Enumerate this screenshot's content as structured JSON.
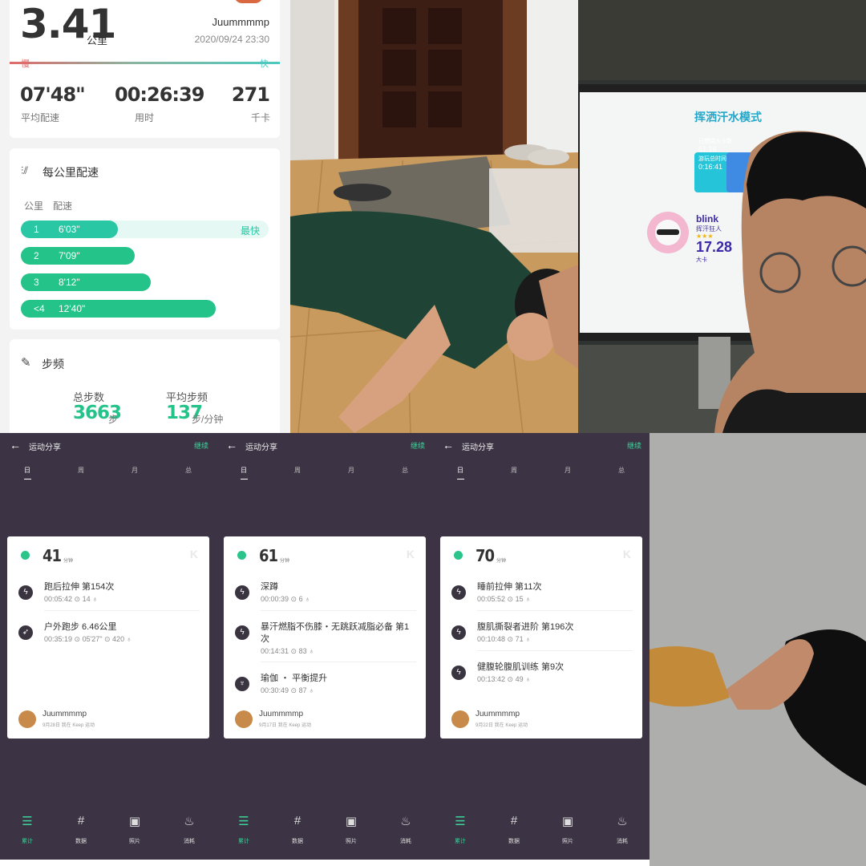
{
  "run": {
    "distance": "3.41",
    "distance_unit": "公里",
    "user": "Juummmmp",
    "datetime": "2020/09/24 23:30",
    "slow_label": "慢",
    "fast_label": "快",
    "stats": [
      {
        "value": "07'48\"",
        "label": "平均配速"
      },
      {
        "value": "00:26:39",
        "label": "用时"
      },
      {
        "value": "271",
        "label": "千卡"
      }
    ],
    "pace_title": "每公里配速",
    "pace_col_km": "公里",
    "pace_col_pace": "配速",
    "fastest_label": "最快",
    "splits": [
      {
        "km": "1",
        "pace": "6'03\"",
        "fraction": 0.36
      },
      {
        "km": "2",
        "pace": "7'09\"",
        "fraction": 0.42
      },
      {
        "km": "3",
        "pace": "8'12\"",
        "fraction": 0.48
      },
      {
        "km": "<4",
        "pace": "12'40\"",
        "fraction": 0.72
      }
    ],
    "cadence_title": "步频",
    "total_steps_label": "总步数",
    "total_steps": "3663",
    "total_steps_unit": "步",
    "avg_cadence_label": "平均步频",
    "avg_cadence": "137",
    "avg_cadence_unit": "步/分钟"
  },
  "screen_photo": {
    "title": "挥洒汗水模式",
    "box_label1": "已燃烧大卡数",
    "box_value1": "61.16",
    "box_label2": "游玩总时间",
    "box_value2": "0:16:41",
    "player": "blink",
    "player_sub": "挥汗狂人",
    "stars": "★★★",
    "score": "17.28",
    "score_unit": "大卡"
  },
  "shares": [
    {
      "header": "运动分享",
      "continue": "继续",
      "tabs": [
        "日",
        "周",
        "月",
        "总"
      ],
      "minutes": "41",
      "minutes_unit": "分钟",
      "activities": [
        {
          "icon": "lightning-icon",
          "name": "跑后拉伸 第154次",
          "detail": "00:05:42 ⊙   14 ♁"
        },
        {
          "icon": "runner-icon",
          "name": "户外跑步 6.46公里",
          "detail": "00:35:19 ⊙   05'27\" ⊙   420 ♁"
        }
      ],
      "user": "Juummmmp",
      "date_line": "9月28日 我在 Keep 运动",
      "nav": [
        "累计",
        "数据",
        "照片",
        "消耗"
      ]
    },
    {
      "header": "运动分享",
      "continue": "继续",
      "tabs": [
        "日",
        "周",
        "月",
        "总"
      ],
      "minutes": "61",
      "minutes_unit": "分钟",
      "activities": [
        {
          "icon": "lightning-icon",
          "name": "深蹲",
          "detail": "00:00:39 ⊙   6 ♁"
        },
        {
          "icon": "lightning-icon",
          "name": "暴汗燃脂不伤膝・无跳跃减脂必备 第1次",
          "detail": "00:14:31 ⊙   83 ♁"
        },
        {
          "icon": "yoga-icon",
          "name": "瑜伽 ・ 平衡提升",
          "detail": "00:30:49 ⊙   87 ♁"
        }
      ],
      "user": "Juummmmp",
      "date_line": "9月17日 我在 Keep 运动",
      "nav": [
        "累计",
        "数据",
        "照片",
        "消耗"
      ]
    },
    {
      "header": "运动分享",
      "continue": "继续",
      "tabs": [
        "日",
        "周",
        "月",
        "总"
      ],
      "minutes": "70",
      "minutes_unit": "分钟",
      "activities": [
        {
          "icon": "lightning-icon",
          "name": "睡前拉伸 第11次",
          "detail": "00:05:52 ⊙   15 ♁"
        },
        {
          "icon": "lightning-icon",
          "name": "腹肌撕裂者进阶 第196次",
          "detail": "00:10:48 ⊙   71 ♁"
        },
        {
          "icon": "lightning-icon",
          "name": "健腹轮腹肌训练 第9次",
          "detail": "00:13:42 ⊙   49 ♁"
        }
      ],
      "user": "Juummmmp",
      "date_line": "9月22日 我在 Keep 运动",
      "nav": [
        "累计",
        "数据",
        "照片",
        "消耗"
      ]
    }
  ],
  "colors": {
    "accent": "#3ed29b",
    "pace_bar": "#24c389",
    "fastest_bar": "#2ac7a4",
    "share_bg": "#3c3444"
  }
}
